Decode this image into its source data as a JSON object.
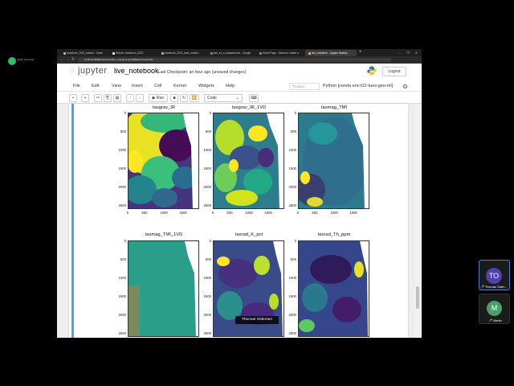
{
  "meeting": {
    "logo_text": "Earth Sciences"
  },
  "browser": {
    "tabs": [
      {
        "label": "transform_2022_tutorial - Great"
      },
      {
        "label": "Github / transform_2022"
      },
      {
        "label": "transform_2022_tutor_notebo..."
      },
      {
        "label": "two_ex_a_datasets.csv - Google"
      },
      {
        "label": "Home Page - Select or create a"
      },
      {
        "label": "live_notebook - Jupyter Notebo..."
      }
    ],
    "new_tab": "+",
    "url": "localhost:8888/notebooks/live_notebook.ipynb#Matrix-the-Points"
  },
  "jupyter": {
    "logo_word": "jupyter",
    "notebook_name": "live_notebook",
    "checkpoint": "Last Checkpoint: an hour ago  (unsaved changes)",
    "logout": "Logout",
    "menu": [
      "File",
      "Edit",
      "View",
      "Insert",
      "Cell",
      "Kernel",
      "Widgets",
      "Help"
    ],
    "trusted": "Trusted",
    "kernel": "Python [conda env:t22-tues-geo-ml]",
    "run_label": "Run",
    "cell_type": "Code"
  },
  "plots": [
    {
      "title": "tasgrav_IR",
      "palette": "smooth"
    },
    {
      "title": "tasgrav_IR_1VD",
      "palette": "noisy"
    },
    {
      "title": "tasmag_TMI",
      "palette": "teal"
    },
    {
      "title": "tasmag_TMI_1VD",
      "palette": "flat"
    },
    {
      "title": "tasrad_K_pct",
      "palette": "dark"
    },
    {
      "title": "tasrad_Th_ppm",
      "palette": "dark2"
    }
  ],
  "axis": {
    "yticks": [
      "0",
      "500",
      "1000",
      "1500",
      "2000",
      "2500"
    ],
    "xticks": [
      "0",
      "500",
      "1000",
      "1500"
    ]
  },
  "speaker_label": "Thomas Ostersen",
  "participants": [
    {
      "initials": "TO",
      "name": "Thomas Oster...",
      "color": "#4a43b0"
    },
    {
      "initials": "M",
      "name": "Martin",
      "color": "#4aa06a"
    }
  ]
}
